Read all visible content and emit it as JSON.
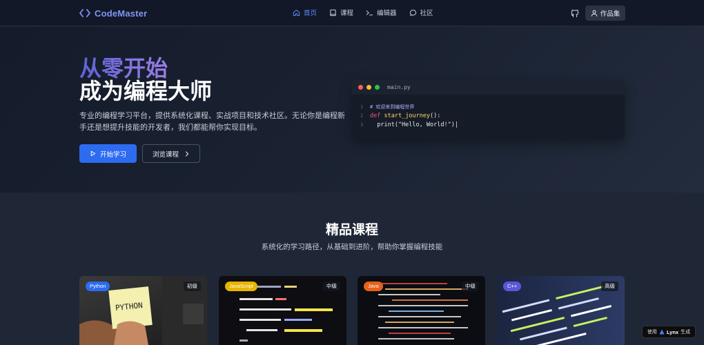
{
  "nav": {
    "brand": "CodeMaster",
    "links": [
      {
        "label": "首页",
        "icon": "home-icon",
        "active": true
      },
      {
        "label": "课程",
        "icon": "book-icon",
        "active": false
      },
      {
        "label": "编辑器",
        "icon": "terminal-icon",
        "active": false
      },
      {
        "label": "社区",
        "icon": "chat-icon",
        "active": false
      }
    ],
    "portfolio_label": "作品集",
    "github_icon": "github-icon"
  },
  "hero": {
    "title_line1": "从零开始",
    "title_line2": "成为编程大师",
    "description": "专业的编程学习平台，提供系统化课程、实战项目和技术社区。无论你是编程新手还是想提升技能的开发者，我们都能帮你实现目标。",
    "primary_button": "开始学习",
    "secondary_button": "浏览课程"
  },
  "code_window": {
    "filename": "main.py",
    "lines": [
      {
        "num": "1",
        "comment": "# 欢迎来到编程世界"
      },
      {
        "num": "2",
        "keyword": "def",
        "func": "start_journey",
        "rest": "():"
      },
      {
        "num": "3",
        "code": "  print(\"Hello, World!\")|"
      }
    ]
  },
  "featured": {
    "title": "精品课程",
    "subtitle": "系统化的学习路径，从基础到进阶，帮助你掌握编程技能",
    "cards": [
      {
        "tag": "Python",
        "level": "初级",
        "tag_color": "#2d6bf0",
        "image_text": "PYTHON"
      },
      {
        "tag": "JavaScript",
        "level": "中级",
        "tag_color": "#e8b400"
      },
      {
        "tag": "Java",
        "level": "中级",
        "tag_color": "#e8611a"
      },
      {
        "tag": "C++",
        "level": "高级",
        "tag_color": "#5b57d9"
      }
    ]
  },
  "badge": {
    "prefix": "使用",
    "brand": "Lynx",
    "suffix": "生成"
  },
  "colors": {
    "accent": "#2d6bf0",
    "brand": "#7f96f5",
    "nav_bg": "#121827",
    "page_bg": "#1f2736"
  }
}
